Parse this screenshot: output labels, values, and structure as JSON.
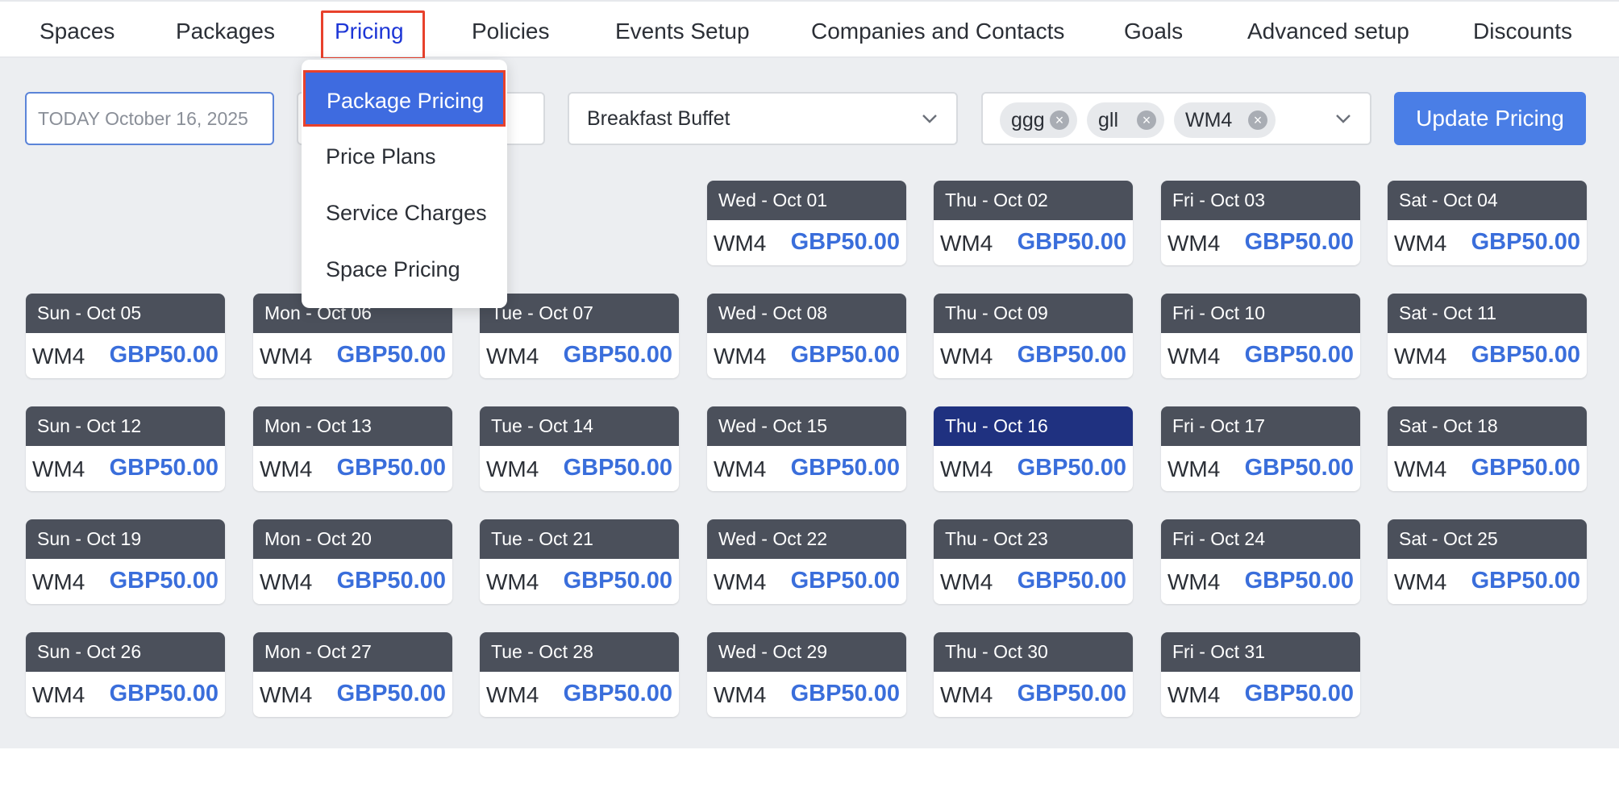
{
  "nav": {
    "items": [
      "Spaces",
      "Packages",
      "Pricing",
      "Policies",
      "Events Setup",
      "Companies and Contacts",
      "Goals",
      "Advanced setup",
      "Discounts"
    ],
    "active": "Pricing"
  },
  "pricing_menu": {
    "items": [
      "Package Pricing",
      "Price Plans",
      "Service Charges",
      "Space Pricing"
    ],
    "selected": "Package Pricing"
  },
  "filters": {
    "date": "TODAY October 16, 2025",
    "package": "Breakfast Buffet",
    "tags": [
      "ggg",
      "gll",
      "WM4"
    ],
    "tag_remove": "×",
    "update_button": "Update Pricing"
  },
  "calendar": {
    "days": [
      {
        "label": "Wed - Oct 01",
        "code": "WM4",
        "price": "GBP50.00"
      },
      {
        "label": "Thu - Oct 02",
        "code": "WM4",
        "price": "GBP50.00"
      },
      {
        "label": "Fri - Oct 03",
        "code": "WM4",
        "price": "GBP50.00"
      },
      {
        "label": "Sat - Oct 04",
        "code": "WM4",
        "price": "GBP50.00"
      },
      {
        "label": "Sun - Oct 05",
        "code": "WM4",
        "price": "GBP50.00"
      },
      {
        "label": "Mon - Oct 06",
        "code": "WM4",
        "price": "GBP50.00"
      },
      {
        "label": "Tue - Oct 07",
        "code": "WM4",
        "price": "GBP50.00"
      },
      {
        "label": "Wed - Oct 08",
        "code": "WM4",
        "price": "GBP50.00"
      },
      {
        "label": "Thu - Oct 09",
        "code": "WM4",
        "price": "GBP50.00"
      },
      {
        "label": "Fri - Oct 10",
        "code": "WM4",
        "price": "GBP50.00"
      },
      {
        "label": "Sat - Oct 11",
        "code": "WM4",
        "price": "GBP50.00"
      },
      {
        "label": "Sun - Oct 12",
        "code": "WM4",
        "price": "GBP50.00"
      },
      {
        "label": "Mon - Oct 13",
        "code": "WM4",
        "price": "GBP50.00"
      },
      {
        "label": "Tue - Oct 14",
        "code": "WM4",
        "price": "GBP50.00"
      },
      {
        "label": "Wed - Oct 15",
        "code": "WM4",
        "price": "GBP50.00"
      },
      {
        "label": "Thu - Oct 16",
        "code": "WM4",
        "price": "GBP50.00",
        "today": true
      },
      {
        "label": "Fri - Oct 17",
        "code": "WM4",
        "price": "GBP50.00"
      },
      {
        "label": "Sat - Oct 18",
        "code": "WM4",
        "price": "GBP50.00"
      },
      {
        "label": "Sun - Oct 19",
        "code": "WM4",
        "price": "GBP50.00"
      },
      {
        "label": "Mon - Oct 20",
        "code": "WM4",
        "price": "GBP50.00"
      },
      {
        "label": "Tue - Oct 21",
        "code": "WM4",
        "price": "GBP50.00"
      },
      {
        "label": "Wed - Oct 22",
        "code": "WM4",
        "price": "GBP50.00"
      },
      {
        "label": "Thu - Oct 23",
        "code": "WM4",
        "price": "GBP50.00"
      },
      {
        "label": "Fri - Oct 24",
        "code": "WM4",
        "price": "GBP50.00"
      },
      {
        "label": "Sat - Oct 25",
        "code": "WM4",
        "price": "GBP50.00"
      },
      {
        "label": "Sun - Oct 26",
        "code": "WM4",
        "price": "GBP50.00"
      },
      {
        "label": "Mon - Oct 27",
        "code": "WM4",
        "price": "GBP50.00"
      },
      {
        "label": "Tue - Oct 28",
        "code": "WM4",
        "price": "GBP50.00"
      },
      {
        "label": "Wed - Oct 29",
        "code": "WM4",
        "price": "GBP50.00"
      },
      {
        "label": "Thu - Oct 30",
        "code": "WM4",
        "price": "GBP50.00"
      },
      {
        "label": "Fri - Oct 31",
        "code": "WM4",
        "price": "GBP50.00"
      }
    ]
  },
  "colors": {
    "nav_active": "#1d36d6",
    "highlight_border": "#e8412c",
    "button_blue": "#4a7ee6",
    "price_blue": "#3a6edb",
    "card_header": "#4b505b",
    "today_header": "#1f3180"
  }
}
